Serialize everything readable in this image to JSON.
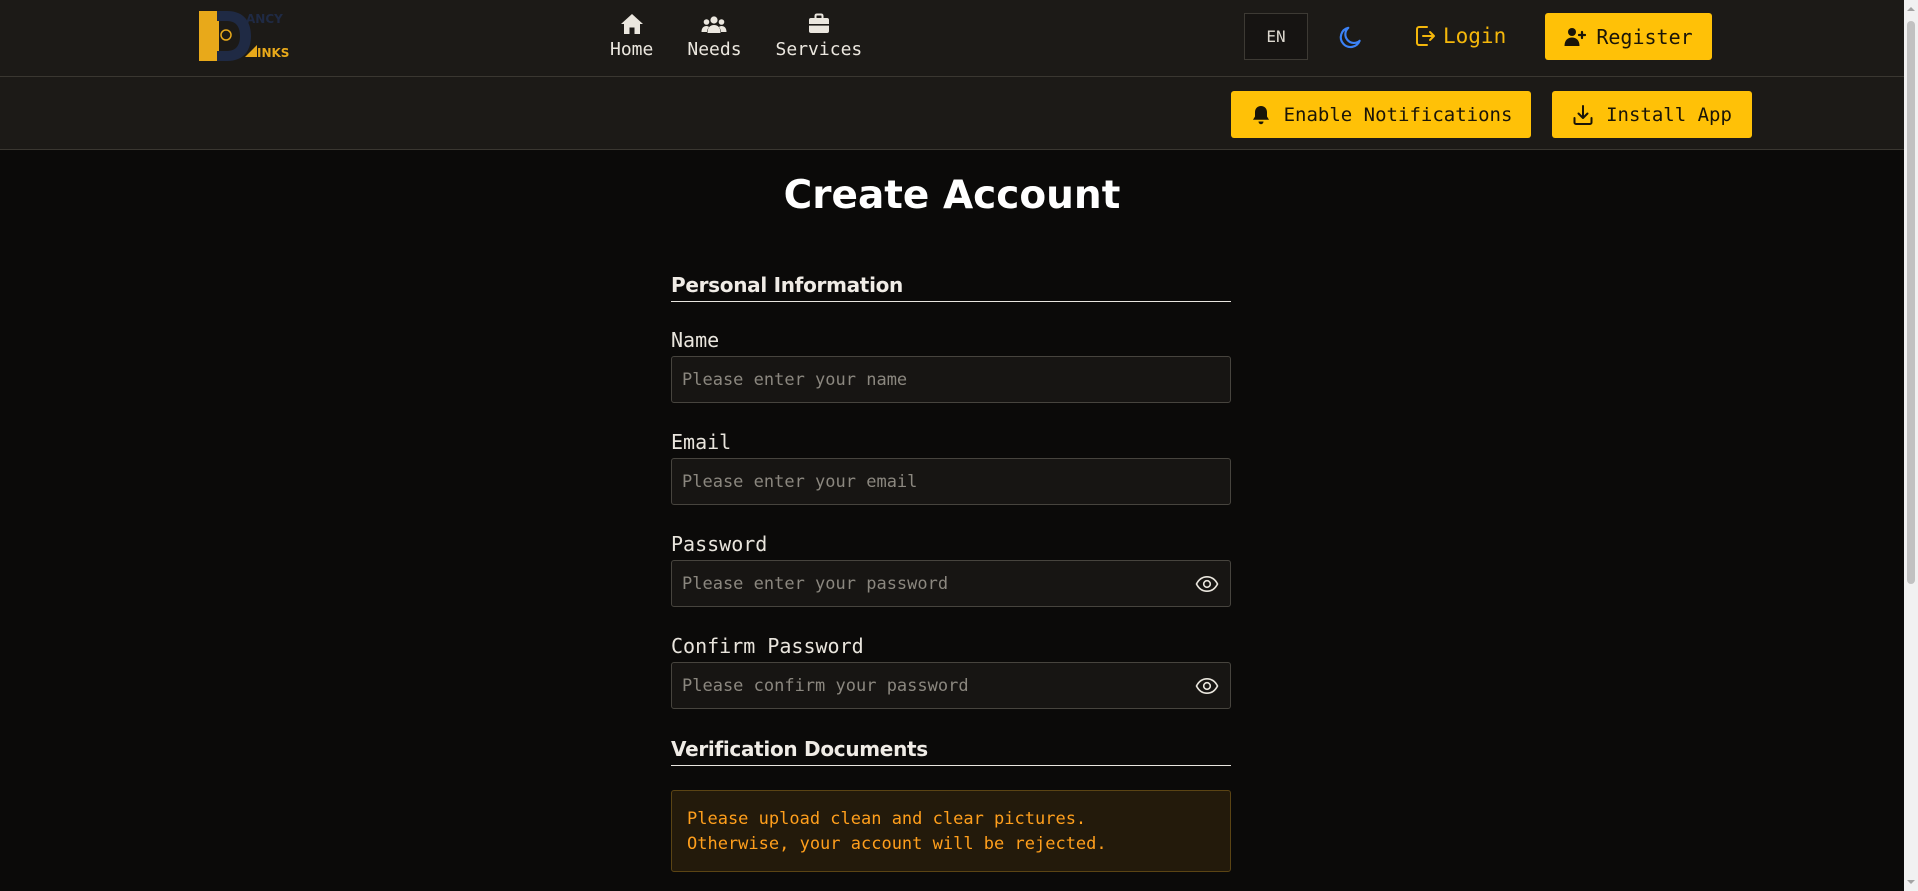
{
  "header": {
    "logo_letters": [
      "D",
      "ANCY",
      "INKS"
    ],
    "nav": [
      {
        "label": "Home",
        "icon": "home-icon"
      },
      {
        "label": "Needs",
        "icon": "users-icon"
      },
      {
        "label": "Services",
        "icon": "briefcase-icon"
      }
    ],
    "language": "EN",
    "theme_icon": "moon-icon",
    "login_label": "Login",
    "register_label": "Register"
  },
  "subbar": {
    "notifications_label": "Enable Notifications",
    "install_label": "Install App"
  },
  "page": {
    "title": "Create Account",
    "personal_section": "Personal Information",
    "fields": {
      "name": {
        "label": "Name",
        "placeholder": "Please enter your name",
        "value": ""
      },
      "email": {
        "label": "Email",
        "placeholder": "Please enter your email",
        "value": ""
      },
      "password": {
        "label": "Password",
        "placeholder": "Please enter your password",
        "value": ""
      },
      "confirm": {
        "label": "Confirm Password",
        "placeholder": "Please confirm your password",
        "value": ""
      }
    },
    "verification_section": "Verification Documents",
    "notice_lines": [
      "Please upload clean and clear pictures.",
      "Otherwise, your account will be rejected."
    ]
  },
  "colors": {
    "accent": "#ffc107",
    "background": "#0b0a09",
    "header_bg": "#1c1a17",
    "notice_text": "#ff9f1c",
    "moon": "#3b82f6"
  }
}
